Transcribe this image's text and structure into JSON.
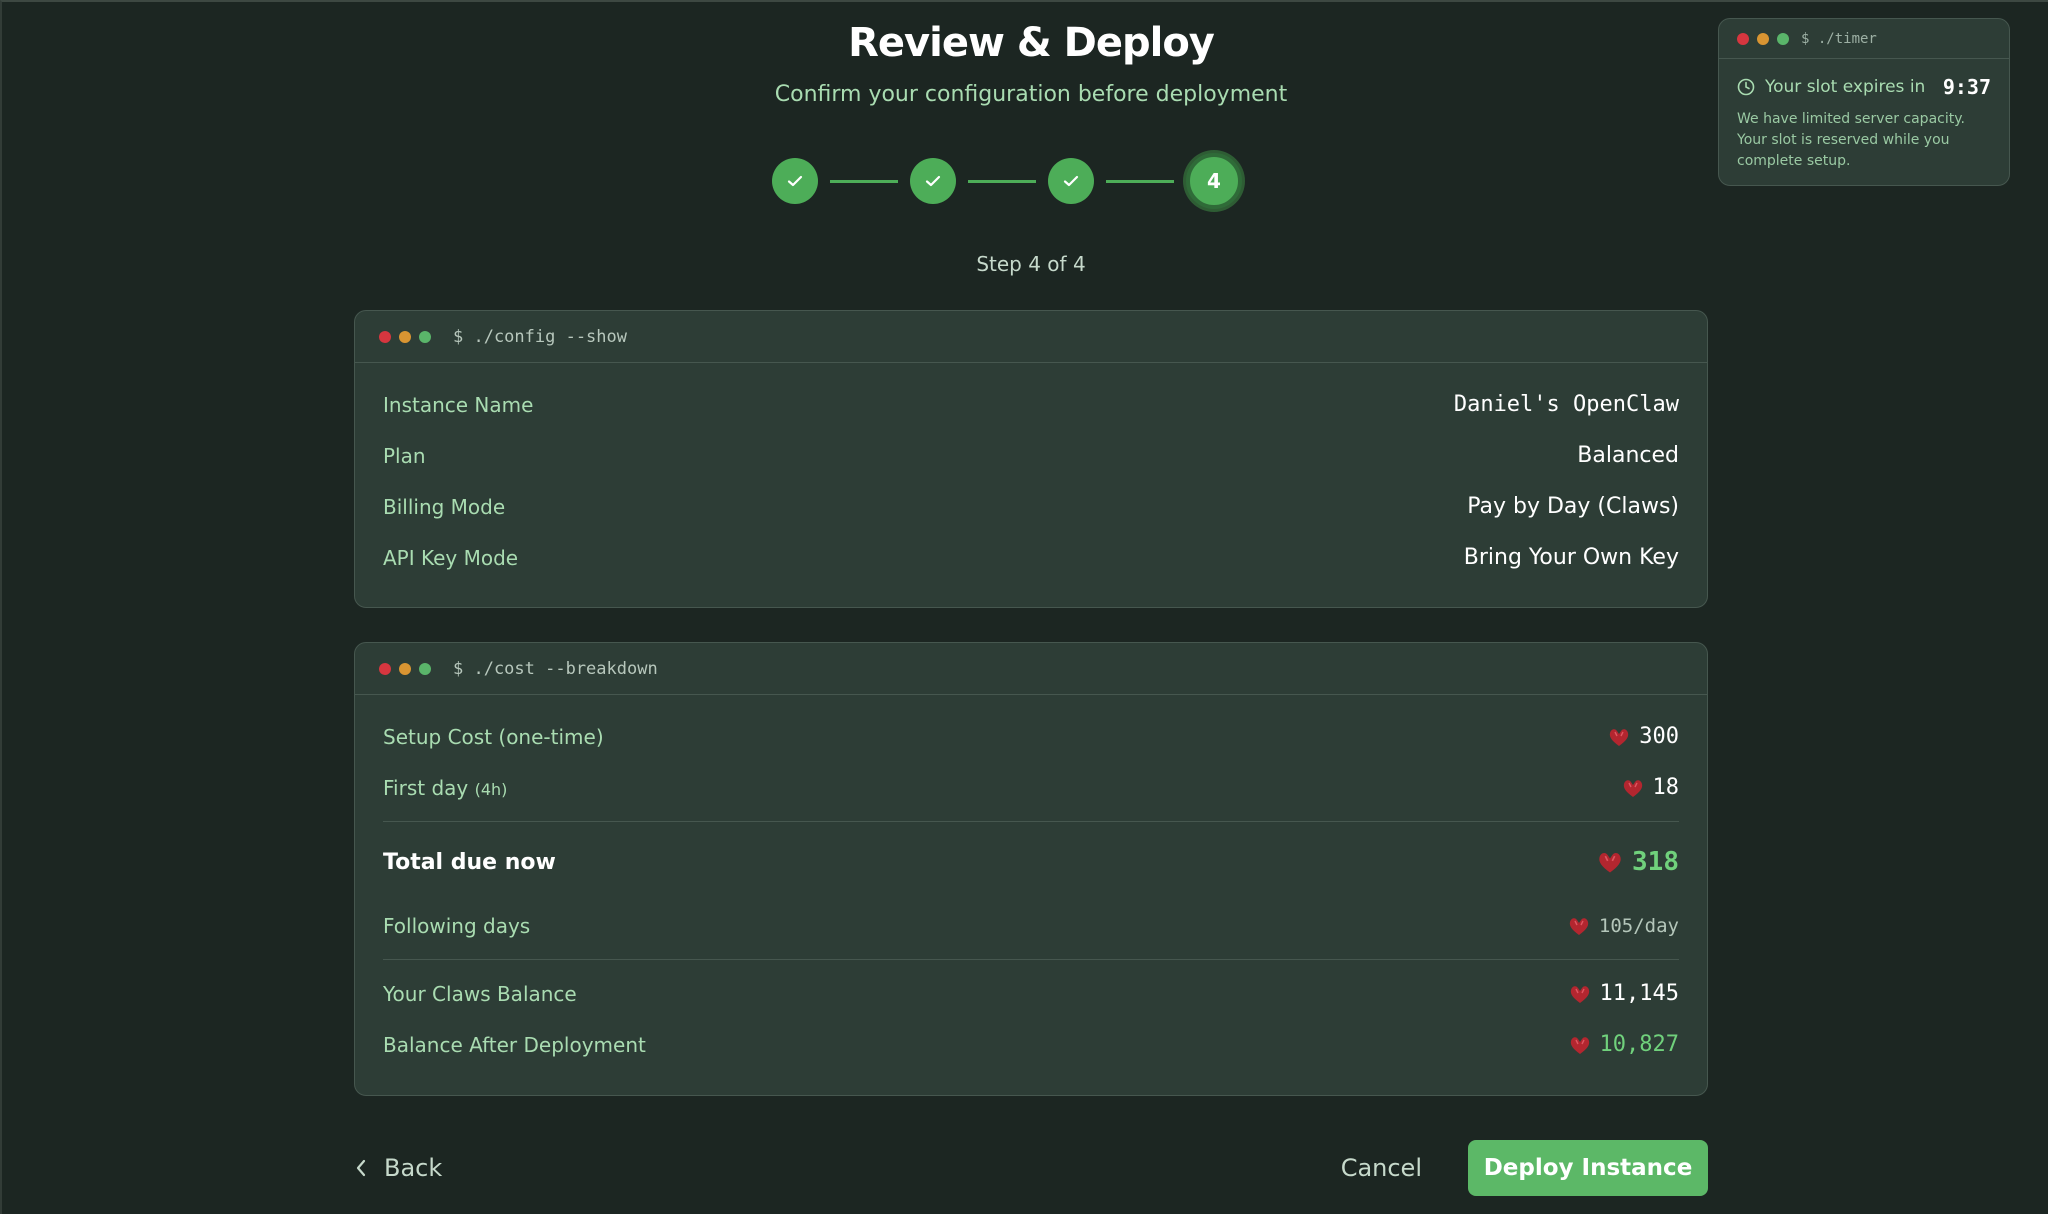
{
  "header": {
    "title": "Review & Deploy",
    "subtitle": "Confirm your configuration before deployment",
    "current_step": "4",
    "step_label": "Step 4 of 4"
  },
  "timer": {
    "command": "$ ./timer",
    "label": "Your slot expires in",
    "value": "9:37",
    "note": "We have limited server capacity. Your slot is reserved while you complete setup."
  },
  "config": {
    "command": "$ ./config --show",
    "rows": [
      {
        "label": "Instance Name",
        "value": "Daniel's OpenClaw"
      },
      {
        "label": "Plan",
        "value": "Balanced"
      },
      {
        "label": "Billing Mode",
        "value": "Pay by Day (Claws)"
      },
      {
        "label": "API Key Mode",
        "value": "Bring Your Own Key"
      }
    ]
  },
  "cost": {
    "command": "$ ./cost --breakdown",
    "setup_label": "Setup Cost (one-time)",
    "setup_value": "300",
    "first_day_label": "First day",
    "first_day_note": "(4h)",
    "first_day_value": "18",
    "total_label": "Total due now",
    "total_value": "318",
    "following_label": "Following days",
    "following_value": "105/day",
    "balance_label": "Your Claws Balance",
    "balance_value": "11,145",
    "after_label": "Balance After Deployment",
    "after_value": "10,827"
  },
  "footer": {
    "back_label": "Back",
    "cancel_label": "Cancel",
    "deploy_label": "Deploy Instance"
  },
  "colors": {
    "accent": "#5cb867",
    "background": "#1c2622",
    "card": "#2d3d36"
  }
}
